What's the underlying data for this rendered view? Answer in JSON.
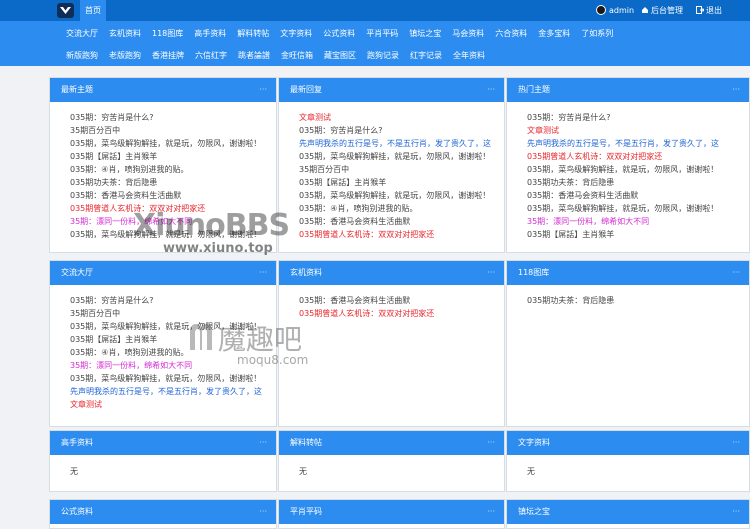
{
  "topbar": {
    "home_label": "首页",
    "user_name": "admin",
    "admin_label": "后台管理",
    "logout_label": "退出"
  },
  "nav": {
    "row1": [
      "交流大厅",
      "玄机资料",
      "118图库",
      "高手资料",
      "解料转帖",
      "文字资料",
      "公式资料",
      "平肖平码",
      "镇坛之宝",
      "马会资料",
      "六合资料",
      "金多宝料",
      "了如系列"
    ],
    "row2": [
      "新版跑狗",
      "老版跑狗",
      "香港挂牌",
      "六信红字",
      "跳者論譜",
      "金旺信箱",
      "藏宝图区",
      "跑狗记录",
      "红字记录",
      "全年资料"
    ]
  },
  "cards": {
    "latest": {
      "title": "最新主题",
      "dots": "···"
    },
    "reply": {
      "title": "最新回复",
      "dots": "···"
    },
    "hot": {
      "title": "热门主题",
      "dots": "···"
    },
    "hall": {
      "title": "交流大厅",
      "dots": "···"
    },
    "xuanji": {
      "title": "玄机资料",
      "dots": "···"
    },
    "gallery": {
      "title": "118图库",
      "dots": "···"
    },
    "gaoshou": {
      "title": "高手资料",
      "dots": "···",
      "empty": "无"
    },
    "jieliao": {
      "title": "解料转帖",
      "dots": "···",
      "empty": "无"
    },
    "wenzi": {
      "title": "文字资料",
      "dots": "···",
      "empty": "无"
    },
    "gongshi": {
      "title": "公式资料",
      "dots": "···"
    },
    "pingxiao": {
      "title": "平肖平码",
      "dots": "···"
    },
    "zhentan": {
      "title": "镇坛之宝",
      "dots": "···"
    }
  },
  "lists": {
    "latest": [
      {
        "text": "035期：穷苦肖是什么?",
        "color": "default"
      },
      {
        "text": "35期百分百中",
        "color": "default"
      },
      {
        "text": "035期，菜鸟级解狗解挂，就是玩，勿限风，谢谢啦！",
        "color": "default"
      },
      {
        "text": "035期【屌話】主肖猴羊",
        "color": "default"
      },
      {
        "text": "035期：④肖，喷狗别进我的贴。",
        "color": "default"
      },
      {
        "text": "035期功夫茶：背后隐患",
        "color": "default"
      },
      {
        "text": "035期：香港马会资料生活曲默",
        "color": "default"
      },
      {
        "text": "035期曾道人玄机诗：双双对对把家还",
        "color": "red"
      },
      {
        "text": "35期：漂同一份料，绵希如大不同",
        "color": "magenta"
      },
      {
        "text": "035期，菜鸟级解狗解挂，就是玩，勿限风，谢谢啦！",
        "color": "default"
      }
    ],
    "reply": [
      {
        "text": "文章测试",
        "color": "red"
      },
      {
        "text": "035期：穷苦肖是什么?",
        "color": "default"
      },
      {
        "text": "先声明我杀的五行是号，不是五行肖，发了贵久了，这",
        "color": "blue"
      },
      {
        "text": "035期，菜鸟级解狗解挂，就是玩，勿限风，谢谢啦！",
        "color": "default"
      },
      {
        "text": "35期百分百中",
        "color": "default"
      },
      {
        "text": "035期【屌話】主肖猴羊",
        "color": "default"
      },
      {
        "text": "035期，菜鸟级解狗解挂，就是玩，勿限风，谢谢啦！",
        "color": "default"
      },
      {
        "text": "035期：④肖，喷狗别进我的贴。",
        "color": "default"
      },
      {
        "text": "035期：香港马会资料生活曲默",
        "color": "default"
      },
      {
        "text": "035期曾道人玄机诗：双双对对把家还",
        "color": "red"
      }
    ],
    "hot": [
      {
        "text": "035期：穷苦肖是什么?",
        "color": "default"
      },
      {
        "text": "文章测试",
        "color": "red"
      },
      {
        "text": "先声明我杀的五行是号，不是五行肖，发了贵久了，这",
        "color": "blue"
      },
      {
        "text": "035期曾道人玄机诗：双双对对把家还",
        "color": "red"
      },
      {
        "text": "035期，菜鸟级解狗解挂，就是玩，勿限风，谢谢啦！",
        "color": "default"
      },
      {
        "text": "035期功夫茶：背后隐患",
        "color": "default"
      },
      {
        "text": "035期：香港马会资料生活曲默",
        "color": "default"
      },
      {
        "text": "035期，菜鸟级解狗解挂，就是玩，勿限风，谢谢啦！",
        "color": "default"
      },
      {
        "text": "35期：漂同一份料，绵希如大不同",
        "color": "magenta"
      },
      {
        "text": "035期【屌話】主肖猴羊",
        "color": "default"
      }
    ],
    "hall": [
      {
        "text": "035期：穷苦肖是什么?",
        "color": "default"
      },
      {
        "text": "35期百分百中",
        "color": "default"
      },
      {
        "text": "035期，菜鸟级解狗解挂，就是玩，勿限风，谢谢啦！",
        "color": "default"
      },
      {
        "text": "035期【屌話】主肖猴羊",
        "color": "default"
      },
      {
        "text": "035期：④肖，喷狗别进我的贴。",
        "color": "default"
      },
      {
        "text": "35期：漂同一份料，绵希如大不同",
        "color": "magenta"
      },
      {
        "text": "035期，菜鸟级解狗解挂，就是玩，勿限风，谢谢啦！",
        "color": "default"
      },
      {
        "text": "先声明我杀的五行是号，不是五行肖，发了贵久了，这",
        "color": "blue"
      },
      {
        "text": "文章测试",
        "color": "red"
      }
    ],
    "xuanji": [
      {
        "text": "035期：香港马会资料生活曲默",
        "color": "default"
      },
      {
        "text": "035期曾道人玄机诗：双双对对把家还",
        "color": "red"
      }
    ],
    "gallery": [
      {
        "text": "035期功夫茶：背后隐患",
        "color": "default"
      }
    ]
  },
  "watermarks": {
    "xiuno": "XiunoBBS",
    "xiuno_url": "www.xiuno.top",
    "moqu": "魔趣吧",
    "moqu_url": "moqu8.com"
  }
}
